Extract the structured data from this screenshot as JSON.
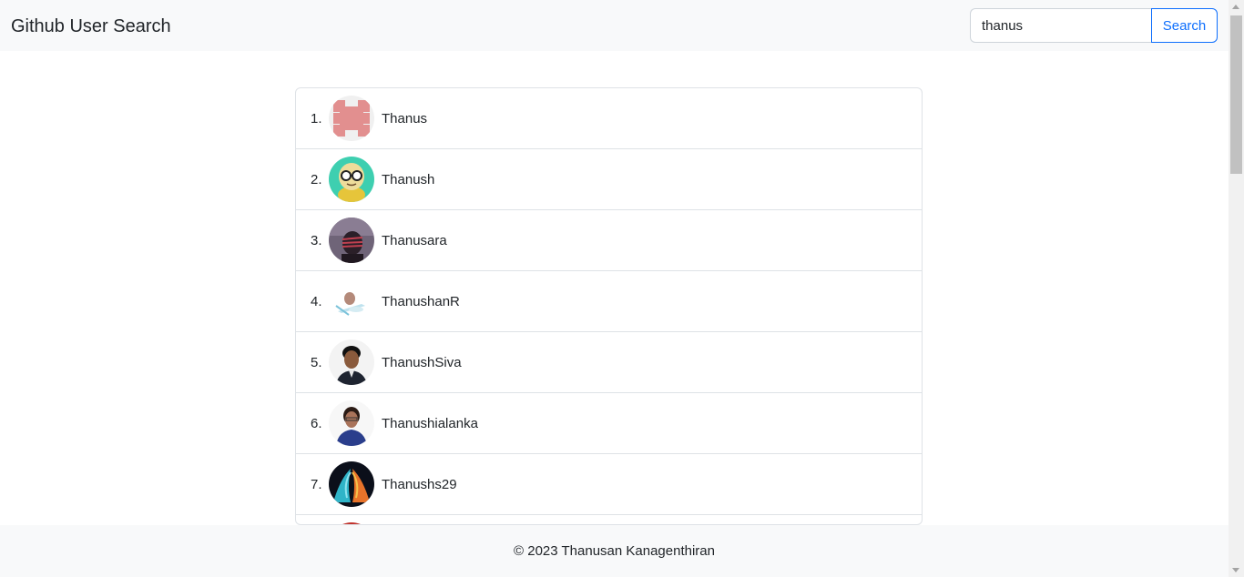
{
  "header": {
    "title": "Github User Search",
    "search_value": "thanus",
    "search_button": "Search"
  },
  "results": [
    {
      "index": "1.",
      "login": "Thanus",
      "avatar": "identicon-avatar"
    },
    {
      "index": "2.",
      "login": "Thanush",
      "avatar": "cartoon-avatar"
    },
    {
      "index": "3.",
      "login": "Thanusara",
      "avatar": "photo-avatar"
    },
    {
      "index": "4.",
      "login": "ThanushanR",
      "avatar": "photo-avatar"
    },
    {
      "index": "5.",
      "login": "ThanushSiva",
      "avatar": "photo-avatar"
    },
    {
      "index": "6.",
      "login": "Thanushialanka",
      "avatar": "photo-avatar"
    },
    {
      "index": "7.",
      "login": "Thanushs29",
      "avatar": "photo-avatar"
    },
    {
      "index": "",
      "login": "",
      "avatar": "photo-avatar"
    }
  ],
  "footer": {
    "copyright": "© 2023 Thanusan Kanagenthiran"
  },
  "colors": {
    "accent": "#0d6efd",
    "navbar_bg": "#f8f9fa",
    "border": "#dee2e6"
  }
}
